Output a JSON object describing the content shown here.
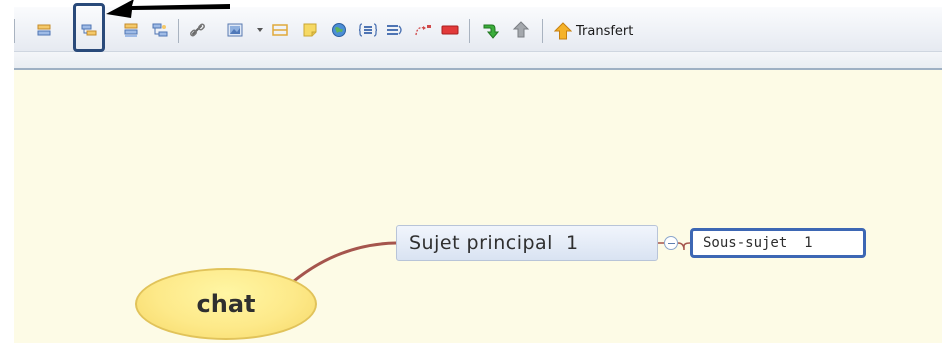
{
  "toolbar": {
    "buttons": [
      {
        "name": "insert-topic-icon"
      },
      {
        "name": "insert-subtopic-icon"
      },
      {
        "name": "insert-topic-before-icon"
      },
      {
        "name": "insert-parent-topic-icon"
      },
      {
        "name": "hyperlink-icon"
      },
      {
        "name": "image-icon"
      },
      {
        "name": "image-dropdown-icon"
      },
      {
        "name": "boundary-icon"
      },
      {
        "name": "note-icon"
      },
      {
        "name": "globe-icon"
      },
      {
        "name": "summary-icon"
      },
      {
        "name": "list-icon"
      },
      {
        "name": "relationship-icon"
      },
      {
        "name": "label-icon"
      },
      {
        "name": "drill-down-icon"
      },
      {
        "name": "drill-up-icon"
      }
    ],
    "transfer_label": "Transfert",
    "transfer_icon": "up-arrow-icon"
  },
  "mindmap": {
    "central_topic": "chat",
    "main_topic": "Sujet principal  1",
    "sub_topic": "Sous-sujet  1"
  },
  "colors": {
    "canvas_background": "#fdfbe6",
    "central_topic_fill": "#fde989",
    "connector": "#a5554d",
    "selection_border": "#3d67b4",
    "highlight_box": "#2a4a7a"
  }
}
